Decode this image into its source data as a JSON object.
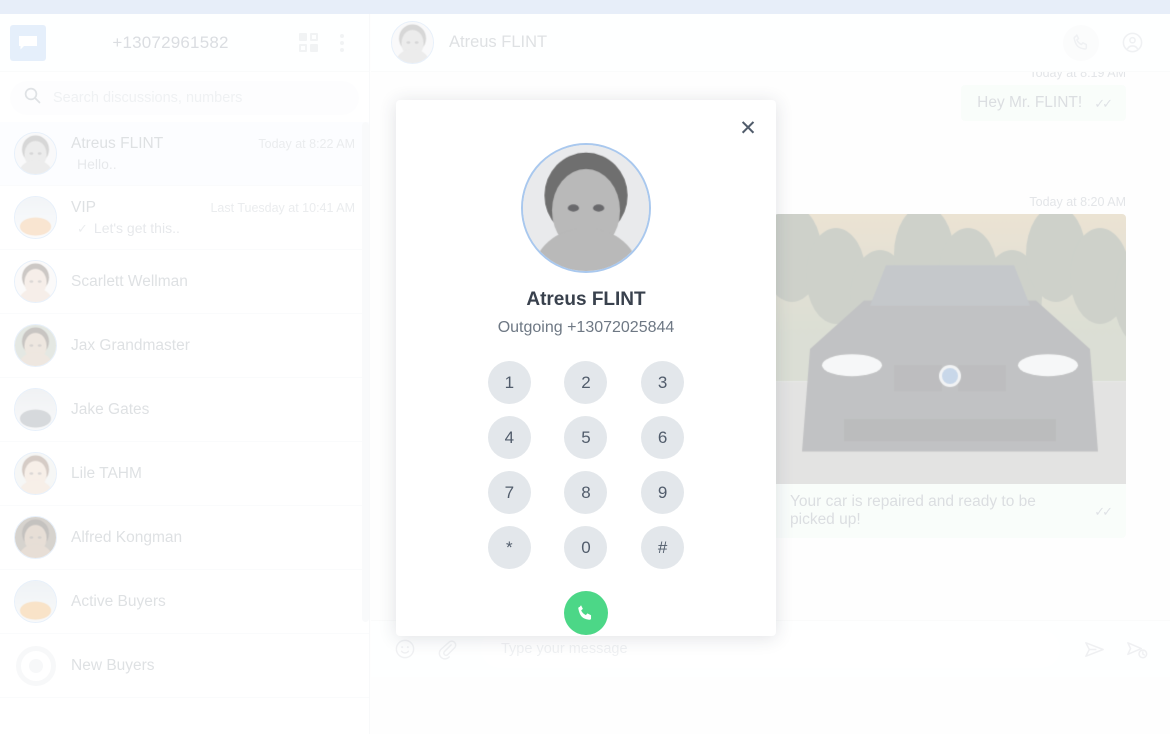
{
  "theme": {
    "accent_bar": "#a8c1ea",
    "avatar_ring": "#a9c8ee",
    "call_green": "#4cd787",
    "bubble_green": "#eaf6ee"
  },
  "left_panel": {
    "logo_icon": "chat-bubble-icon",
    "account_number": "+13072961582",
    "apps_icon": "grid-apps-icon",
    "menu_icon": "kebab-menu-icon",
    "search": {
      "icon": "search-icon",
      "placeholder": "Search discussions, numbers",
      "value": ""
    },
    "conversations": [
      {
        "name": "Atreus FLINT",
        "time": "Today at 8:22 AM",
        "preview": "Hello..",
        "has_check": false,
        "avatar": "man-bald-photo",
        "active": true
      },
      {
        "name": "VIP",
        "time": "Last Tuesday at 10:41 AM",
        "preview": "Let's get this..",
        "has_check": true,
        "avatar": "mountain-photo",
        "active": false
      },
      {
        "name": "Scarlett Wellman",
        "time": "",
        "preview": "",
        "has_check": false,
        "avatar": "woman-bun-photo",
        "active": false
      },
      {
        "name": "Jax Grandmaster",
        "time": "",
        "preview": "",
        "has_check": false,
        "avatar": "man-young-photo",
        "active": false
      },
      {
        "name": "Jake Gates",
        "time": "",
        "preview": "",
        "has_check": false,
        "avatar": "grey-car-photo",
        "active": false
      },
      {
        "name": "Lile TAHM",
        "time": "",
        "preview": "",
        "has_check": false,
        "avatar": "woman-bob-photo",
        "active": false
      },
      {
        "name": "Alfred Kongman",
        "time": "",
        "preview": "",
        "has_check": false,
        "avatar": "man-beard-photo",
        "active": false
      },
      {
        "name": "Active Buyers",
        "time": "",
        "preview": "",
        "has_check": false,
        "avatar": "orange-car-photo",
        "active": false
      },
      {
        "name": "New Buyers",
        "time": "",
        "preview": "",
        "has_check": false,
        "avatar": "target-ring-icon",
        "active": false
      }
    ]
  },
  "chat": {
    "header": {
      "contact_name": "Atreus FLINT",
      "avatar": "man-bald-photo",
      "call_icon": "phone-icon",
      "profile_icon": "person-circle-icon"
    },
    "messages": [
      {
        "time": "Today at 8:19 AM",
        "text": "Hey Mr. FLINT!",
        "type": "text",
        "outgoing": true,
        "status_icon": "double-check-icon"
      },
      {
        "time": "Today at 8:20 AM",
        "text": "Your car is repaired and ready to be picked up!",
        "type": "image",
        "image": "bmw-car-photo",
        "outgoing": true,
        "status_icon": "double-check-icon"
      }
    ],
    "composer": {
      "emoji_icon": "emoji-smiley-icon",
      "attach_icon": "paperclip-icon",
      "placeholder": "Type your message",
      "value": "",
      "send_icon": "send-paper-plane-icon",
      "schedule_icon": "schedule-send-icon"
    }
  },
  "call_modal": {
    "close_icon": "close-x-icon",
    "avatar": "man-bald-photo",
    "contact_name": "Atreus FLINT",
    "call_status": "Outgoing +13072025844",
    "keys": [
      "1",
      "2",
      "3",
      "4",
      "5",
      "6",
      "7",
      "8",
      "9",
      "*",
      "0",
      "#"
    ],
    "call_button_icon": "phone-handset-icon"
  }
}
